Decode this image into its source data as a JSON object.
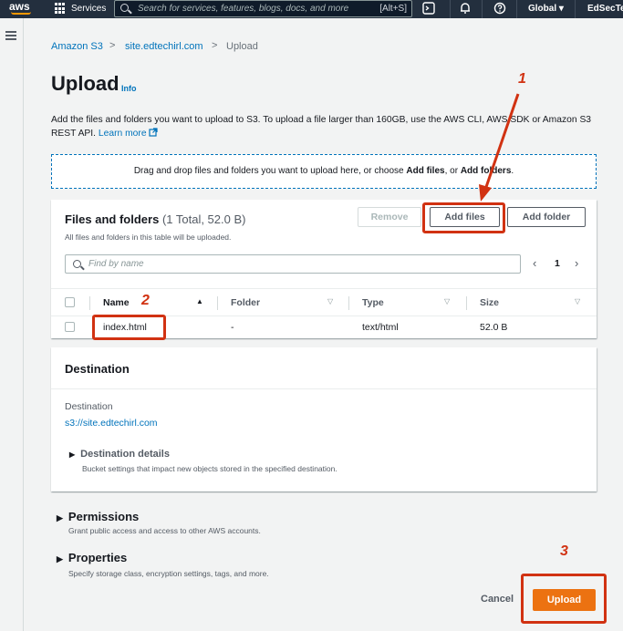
{
  "topnav": {
    "logo": "aws",
    "services_label": "Services",
    "search_placeholder": "Search for services, features, blogs, docs, and more",
    "search_shortcut": "[Alt+S]",
    "region": "Global ▾",
    "account": "EdSecTech"
  },
  "breadcrumb": {
    "s3": "Amazon S3",
    "bucket": "site.edtechirl.com",
    "current": "Upload",
    "separator": ">"
  },
  "header": {
    "title": "Upload",
    "info": "Info"
  },
  "description": {
    "text": "Add the files and folders you want to upload to S3. To upload a file larger than 160GB, use the AWS CLI, AWS SDK or Amazon S3 REST API.",
    "link": "Learn more",
    "link_icon": "external-link-icon"
  },
  "dropzone": {
    "prefix": "Drag and drop files and folders you want to upload here, or choose",
    "add_files": "Add files",
    "or": ", or",
    "add_folders": "Add folders",
    "suffix": "."
  },
  "files_panel": {
    "title": "Files and folders",
    "count": "(1 Total, 52.0 B)",
    "subtitle": "All files and folders in this table will be uploaded.",
    "remove_label": "Remove",
    "add_files_label": "Add files",
    "add_folder_label": "Add folder",
    "find_placeholder": "Find by name",
    "page": "1",
    "prev": "‹",
    "next": "›",
    "columns": [
      "Name",
      "Folder",
      "Type",
      "Size"
    ],
    "rows": [
      {
        "name": "index.html",
        "folder": "-",
        "type": "text/html",
        "size": "52.0 B"
      }
    ]
  },
  "destination": {
    "title": "Destination",
    "label": "Destination",
    "uri": "s3://site.edtechirl.com",
    "details_label": "Destination details",
    "details_sub": "Bucket settings that impact new objects stored in the specified destination."
  },
  "permissions": {
    "title": "Permissions",
    "sub": "Grant public access and access to other AWS accounts."
  },
  "properties": {
    "title": "Properties",
    "sub": "Specify storage class, encryption settings, tags, and more."
  },
  "actions": {
    "cancel": "Cancel",
    "upload": "Upload"
  },
  "annotations": {
    "marker1": "1",
    "marker2": "2",
    "marker3": "3",
    "color": "#d13212"
  }
}
